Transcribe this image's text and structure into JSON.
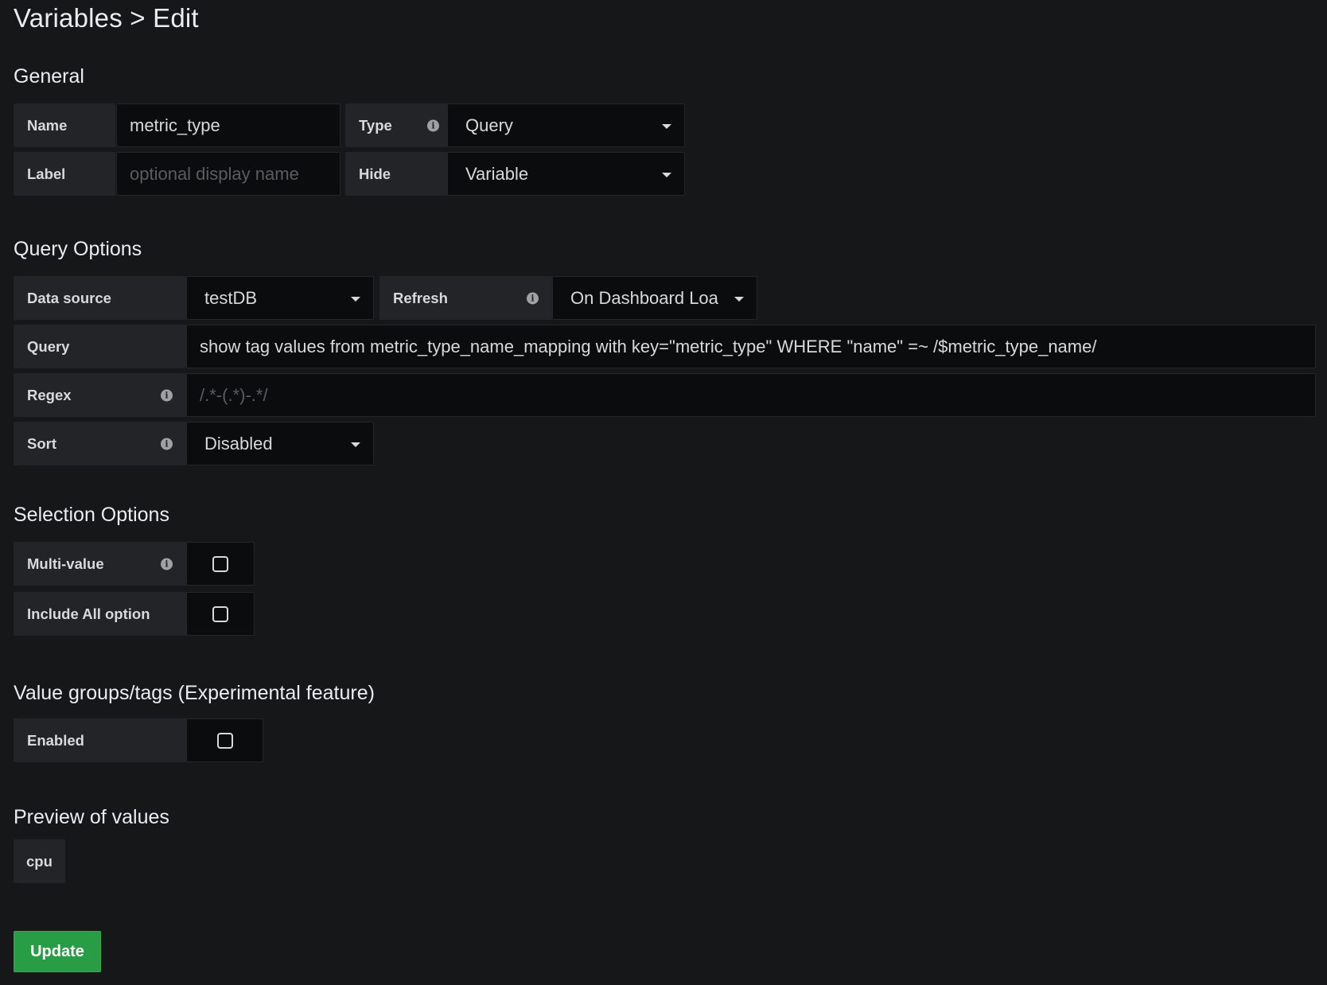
{
  "page_title": "Variables > Edit",
  "general": {
    "title": "General",
    "name_label": "Name",
    "name_value": "metric_type",
    "type_label": "Type",
    "type_value": "Query",
    "label_label": "Label",
    "label_placeholder": "optional display name",
    "hide_label": "Hide",
    "hide_value": "Variable"
  },
  "query_options": {
    "title": "Query Options",
    "datasource_label": "Data source",
    "datasource_value": "testDB",
    "refresh_label": "Refresh",
    "refresh_value": "On Dashboard Loa",
    "query_label": "Query",
    "query_value": "show tag values from metric_type_name_mapping with key=\"metric_type\" WHERE \"name\" =~ /$metric_type_name/",
    "regex_label": "Regex",
    "regex_placeholder": "/.*-(.*)-.*/",
    "sort_label": "Sort",
    "sort_value": "Disabled"
  },
  "selection_options": {
    "title": "Selection Options",
    "multi_value_label": "Multi-value",
    "multi_value_checked": false,
    "include_all_label": "Include All option",
    "include_all_checked": false
  },
  "value_groups": {
    "title": "Value groups/tags (Experimental feature)",
    "enabled_label": "Enabled",
    "enabled_checked": false
  },
  "preview": {
    "title": "Preview of values",
    "values": [
      "cpu"
    ]
  },
  "update_button_label": "Update",
  "icons": {
    "info": "info-circle-icon",
    "caret": "caret-down-icon",
    "checkbox": "checkbox-icon"
  },
  "colors": {
    "background": "#161719",
    "label_bg": "#232427",
    "input_bg": "#0b0c0e",
    "primary_button": "#299c46"
  }
}
